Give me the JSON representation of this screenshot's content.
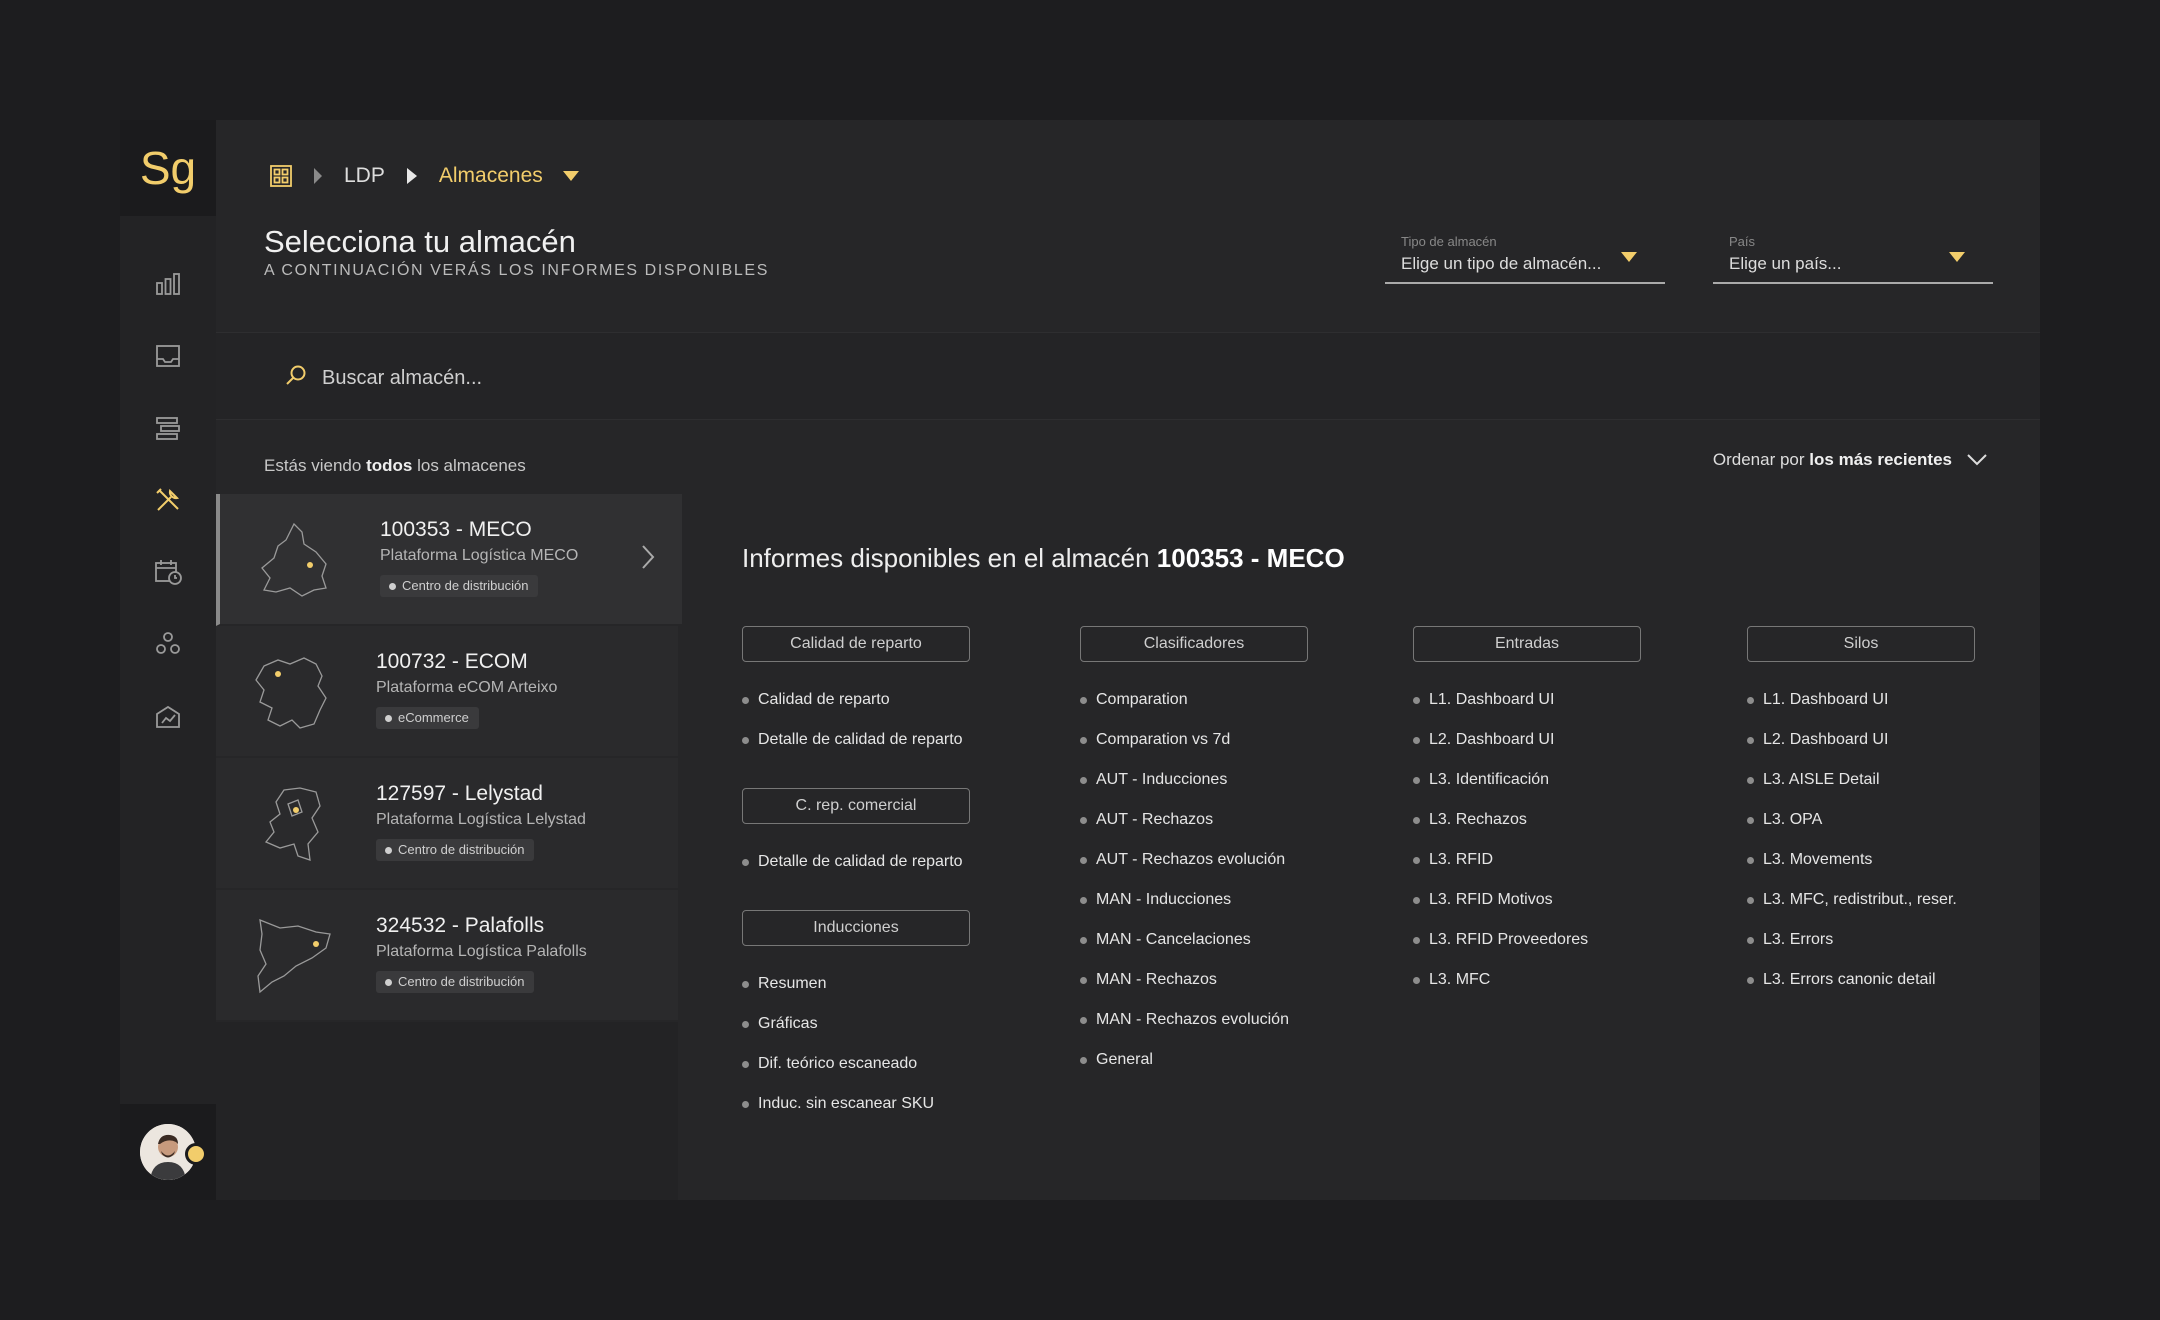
{
  "app": {
    "logo": "Sg"
  },
  "sidebar": {
    "items": [
      "chart-bar-icon",
      "inbox-icon",
      "list-icon",
      "tools-icon",
      "calendar-clock-icon",
      "nodes-icon",
      "building-chart-icon"
    ]
  },
  "breadcrumb": {
    "items": [
      "LDP",
      "Almacenes"
    ]
  },
  "header": {
    "title": "Selecciona tu almacén",
    "subtitle": "A CONTINUACIÓN VERÁS LOS INFORMES DISPONIBLES"
  },
  "filters": {
    "type": {
      "label": "Tipo de almacén",
      "value": "Elige un tipo de almacén..."
    },
    "country": {
      "label": "País",
      "value": "Elige un país..."
    }
  },
  "search": {
    "placeholder": "Buscar almacén..."
  },
  "viewing": {
    "prefix": "Estás viendo",
    "bold": "todos",
    "suffix": "los almacenes"
  },
  "sort": {
    "prefix": "Ordenar por",
    "value": "los más recientes"
  },
  "warehouses": [
    {
      "name": "100353 - MECO",
      "subtitle": "Plataforma Logística MECO",
      "tag": "Centro de distribución"
    },
    {
      "name": "100732 - ECOM",
      "subtitle": "Plataforma eCOM Arteixo",
      "tag": "eCommerce"
    },
    {
      "name": "127597 - Lelystad",
      "subtitle": "Plataforma Logística Lelystad",
      "tag": "Centro de distribución"
    },
    {
      "name": "324532 - Palafolls",
      "subtitle": "Plataforma Logística Palafolls",
      "tag": "Centro de distribución"
    }
  ],
  "reports": {
    "title_prefix": "Informes disponibles en el almacén",
    "warehouse": "100353 - MECO",
    "groups": {
      "calidad": {
        "label": "Calidad de reparto",
        "items": [
          "Calidad de reparto",
          "Detalle de calidad de reparto"
        ]
      },
      "crep": {
        "label": "C. rep. comercial",
        "items": [
          "Detalle de calidad de reparto"
        ]
      },
      "inducciones": {
        "label": "Inducciones",
        "items": [
          "Resumen",
          "Gráficas",
          "Dif. teórico escaneado",
          "Induc. sin escanear SKU"
        ]
      },
      "clasificadores": {
        "label": "Clasificadores",
        "items": [
          "Comparation",
          "Comparation vs 7d",
          "AUT - Inducciones",
          "AUT - Rechazos",
          "AUT - Rechazos evolución",
          "MAN - Inducciones",
          "MAN - Cancelaciones",
          "MAN - Rechazos",
          "MAN - Rechazos evolución",
          "General"
        ]
      },
      "entradas": {
        "label": "Entradas",
        "items": [
          "L1. Dashboard UI",
          "L2. Dashboard UI",
          "L3. Identificación",
          "L3. Rechazos",
          "L3. RFID",
          "L3. RFID Motivos",
          "L3. RFID Proveedores",
          "L3. MFC"
        ]
      },
      "silos": {
        "label": "Silos",
        "items": [
          "L1. Dashboard UI",
          "L2. Dashboard UI",
          "L3. AISLE Detail",
          "L3. OPA",
          "L3. Movements",
          "L3. MFC, redistribut., reser.",
          "L3. Errors",
          "L3. Errors canonic detail"
        ]
      }
    }
  },
  "colors": {
    "accent": "#f2cd6b",
    "background": "#1d1d1f",
    "panel": "#262628"
  }
}
